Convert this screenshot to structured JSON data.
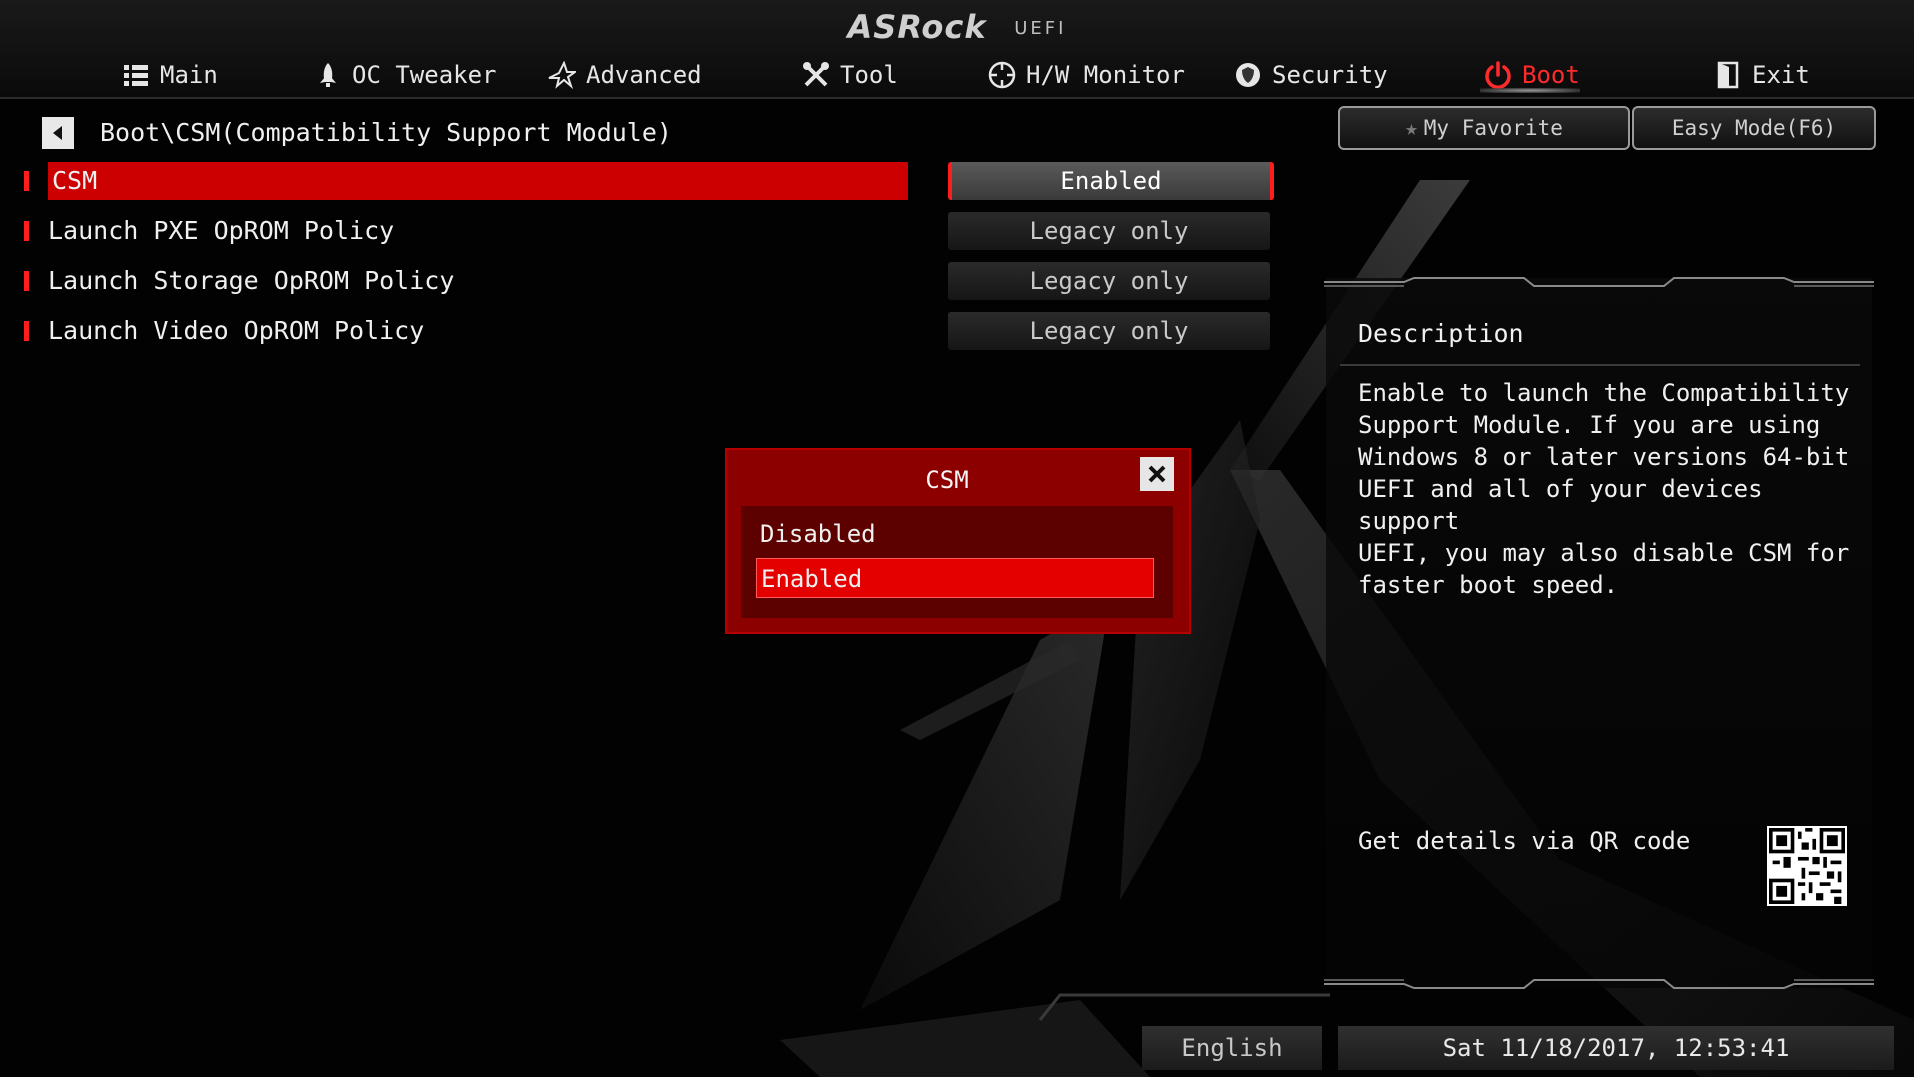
{
  "brand": {
    "logo": "ASRock",
    "suffix": "UEFI"
  },
  "tabs": [
    {
      "label": "Main",
      "icon": "list-icon"
    },
    {
      "label": "OC Tweaker",
      "icon": "rocket-icon"
    },
    {
      "label": "Advanced",
      "icon": "star-icon"
    },
    {
      "label": "Tool",
      "icon": "tools-icon"
    },
    {
      "label": "H/W Monitor",
      "icon": "monitor-icon"
    },
    {
      "label": "Security",
      "icon": "shield-icon"
    },
    {
      "label": "Boot",
      "icon": "power-icon",
      "active": true
    },
    {
      "label": "Exit",
      "icon": "exit-icon"
    }
  ],
  "breadcrumb": "Boot\\CSM(Compatibility Support Module)",
  "buttons": {
    "favorite": "My Favorite",
    "easy_mode": "Easy Mode(F6)"
  },
  "settings": [
    {
      "label": "CSM",
      "value": "Enabled",
      "selected": true
    },
    {
      "label": "Launch PXE OpROM Policy",
      "value": "Legacy only"
    },
    {
      "label": "Launch Storage OpROM Policy",
      "value": "Legacy only"
    },
    {
      "label": "Launch Video OpROM Policy",
      "value": "Legacy only"
    }
  ],
  "popup": {
    "title": "CSM",
    "options": [
      "Disabled",
      "Enabled"
    ],
    "selected": "Enabled"
  },
  "description": {
    "heading": "Description",
    "text": "Enable to launch the Compatibility\nSupport Module. If you are using\nWindows 8 or later versions 64-bit\nUEFI and all of your devices support\nUEFI, you may also disable CSM for\nfaster boot speed.",
    "qr_label": "Get details via QR code"
  },
  "status": {
    "language": "English",
    "datetime": "Sat 11/18/2017, 12:53:41"
  },
  "colors": {
    "accent": "#cc0000",
    "active_tab": "#ff2b2b",
    "popup": "#8c0000"
  }
}
